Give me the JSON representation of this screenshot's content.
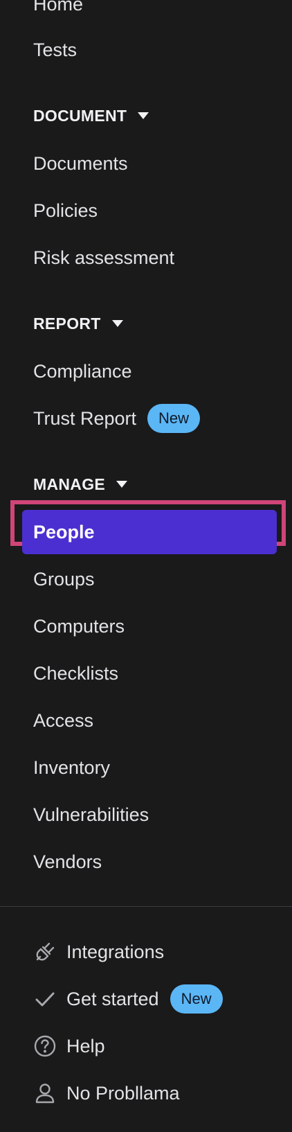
{
  "nav": {
    "top_items": [
      {
        "label": "Home"
      },
      {
        "label": "Tests"
      }
    ],
    "document_section": {
      "title": "DOCUMENT",
      "items": [
        {
          "label": "Documents"
        },
        {
          "label": "Policies"
        },
        {
          "label": "Risk assessment"
        }
      ]
    },
    "report_section": {
      "title": "REPORT",
      "items": [
        {
          "label": "Compliance"
        },
        {
          "label": "Trust Report",
          "badge": "New"
        }
      ]
    },
    "manage_section": {
      "title": "MANAGE",
      "active_item": "People",
      "items": [
        {
          "label": "Groups"
        },
        {
          "label": "Computers"
        },
        {
          "label": "Checklists"
        },
        {
          "label": "Access"
        },
        {
          "label": "Inventory"
        },
        {
          "label": "Vulnerabilities"
        },
        {
          "label": "Vendors"
        }
      ]
    },
    "bottom_items": [
      {
        "label": "Integrations",
        "icon": "plug-icon"
      },
      {
        "label": "Get started",
        "icon": "check-icon",
        "badge": "New"
      },
      {
        "label": "Help",
        "icon": "help-circle-icon"
      },
      {
        "label": "No Probllama",
        "icon": "user-icon"
      }
    ]
  },
  "colors": {
    "background": "#1a1a1b",
    "active_background": "#4c2fd0",
    "highlight_border": "#cf4577",
    "badge_background": "#5bb6f5"
  }
}
